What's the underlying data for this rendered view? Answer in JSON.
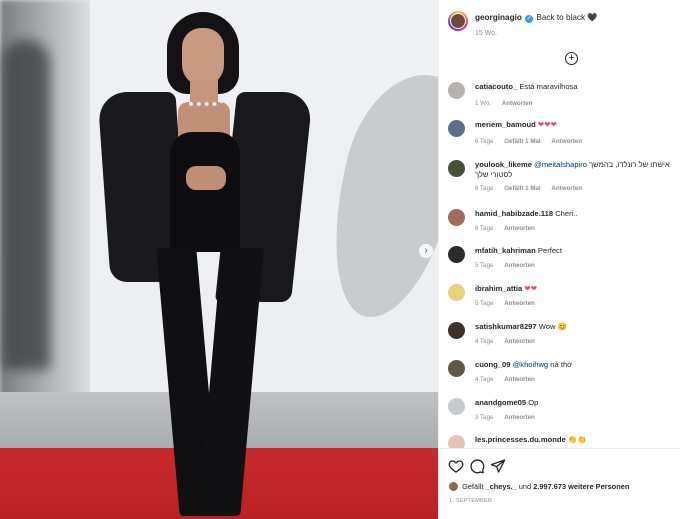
{
  "post": {
    "author": "georginagio",
    "caption": "Back to black",
    "caption_emoji": "🖤",
    "time": "15 Wo."
  },
  "icons": {
    "add": "plus-circle-icon",
    "next": "chevron-right-icon",
    "like": "heart-icon",
    "comment": "comment-icon",
    "share": "send-icon",
    "verified": "verified-badge-icon"
  },
  "comments": [
    {
      "user": "catiacouto_",
      "text": "Está maravilhosa",
      "time": "1 Wo.",
      "likes": "",
      "reply": "Antworten",
      "avatar_color": "#b9b3ad"
    },
    {
      "user": "meriem_bamoud",
      "text": "❤❤❤",
      "time": "6 Tage",
      "likes": "Gefällt 1 Mal",
      "reply": "Antworten",
      "avatar_color": "#5b6f8a"
    },
    {
      "user": "youlook_likeme",
      "mention": "@meitalshapiro",
      "text": "אישתו של רונלדו, בהמשך לסטורי שלך",
      "time": "6 Tage",
      "likes": "Gefällt 1 Mal",
      "reply": "Antworten",
      "avatar_color": "#4a4f38"
    },
    {
      "user": "hamid_habibzade.118",
      "text": "Cheri..",
      "time": "6 Tage",
      "likes": "",
      "reply": "Antworten",
      "avatar_color": "#a46a5a"
    },
    {
      "user": "mfatih_kahriman",
      "text": "Perfect",
      "time": "5 Tage",
      "likes": "",
      "reply": "Antworten",
      "avatar_color": "#2b2b2b"
    },
    {
      "user": "ibrahim_attia",
      "text": "❤❤",
      "time": "5 Tage",
      "likes": "",
      "reply": "Antworten",
      "avatar_color": "#e8d37a"
    },
    {
      "user": "satishkumar8297",
      "text": "Wow 😊",
      "time": "4 Tage",
      "likes": "",
      "reply": "Antworten",
      "avatar_color": "#3d3128"
    },
    {
      "user": "cuong_09",
      "mention": "@khoihwg",
      "text": "ná thở",
      "time": "4 Tage",
      "likes": "",
      "reply": "Antworten",
      "avatar_color": "#5e5a45"
    },
    {
      "user": "anandgome05",
      "text": "Op",
      "time": "3 Tage",
      "likes": "",
      "reply": "Antworten",
      "avatar_color": "#c7c9cc"
    },
    {
      "user": "les.princesses.du.monde",
      "text": "👏👏",
      "time": "",
      "likes": "",
      "reply": "",
      "avatar_color": "#e6c4b2"
    }
  ],
  "likes": {
    "prefix": "Gefällt",
    "user": "_cheys._",
    "middle": "und",
    "count": "2.997.673 weitere Personen"
  },
  "date": "1. SEPTEMBER"
}
